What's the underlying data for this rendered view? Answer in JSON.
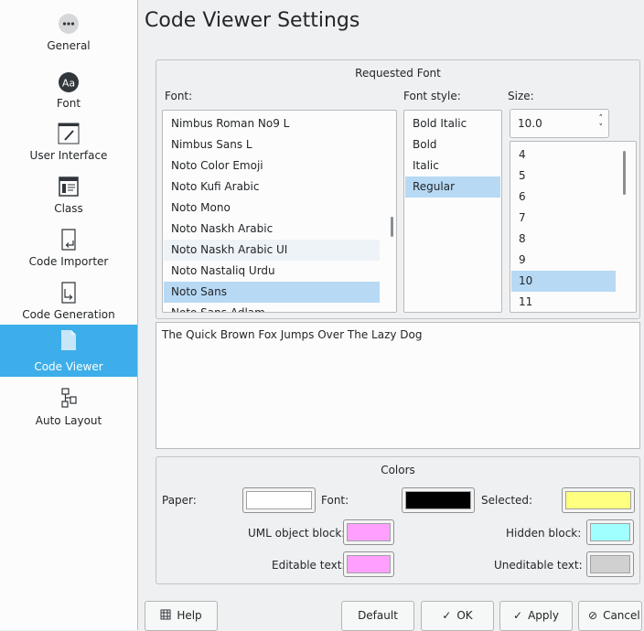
{
  "sidebar": {
    "items": [
      {
        "label": "General",
        "icon": "ellipsis-icon"
      },
      {
        "label": "Font",
        "icon": "font-aa-icon"
      },
      {
        "label": "User Interface",
        "icon": "pen-icon"
      },
      {
        "label": "Class",
        "icon": "class-icon"
      },
      {
        "label": "Code Importer",
        "icon": "code-importer-icon"
      },
      {
        "label": "Code Generation",
        "icon": "code-generation-icon"
      },
      {
        "label": "Code Viewer",
        "icon": "document-icon"
      },
      {
        "label": "Auto Layout",
        "icon": "auto-layout-icon"
      }
    ],
    "active": "Code Viewer",
    "accent": "#3daee9"
  },
  "page": {
    "title": "Code Viewer Settings"
  },
  "font_group": {
    "title": "Requested Font",
    "font_label": "Font:",
    "style_label": "Font style:",
    "size_label": "Size:",
    "fonts": [
      "Nimbus Roman No9 L",
      "Nimbus Sans L",
      "Noto Color Emoji",
      "Noto Kufi Arabic",
      "Noto Mono",
      "Noto Naskh Arabic",
      "Noto Naskh Arabic UI",
      "Noto Nastaliq Urdu",
      "Noto Sans",
      "Noto Sans Adlam"
    ],
    "selected_font": "Noto Sans",
    "styles": [
      "Bold Italic",
      "Bold",
      "Italic",
      "Regular"
    ],
    "selected_style": "Regular",
    "size_value": "10.0",
    "sizes": [
      "4",
      "5",
      "6",
      "7",
      "8",
      "9",
      "10",
      "11"
    ],
    "selected_size": "10"
  },
  "preview": {
    "text": "The Quick Brown Fox Jumps Over The Lazy Dog"
  },
  "colors_group": {
    "title": "Colors",
    "paper_label": "Paper:",
    "font_label": "Font:",
    "selected_label": "Selected:",
    "uml_label": "UML object block:",
    "hidden_label": "Hidden block:",
    "editable_label": "Editable text:",
    "uneditable_label": "Uneditable text:",
    "paper_color": "#ffffff",
    "font_color": "#000000",
    "selected_color": "#ffff80",
    "uml_color": "#ffa0ff",
    "hidden_color": "#a0ffff",
    "editable_color": "#ffa0ff",
    "uneditable_color": "#d0d0d0"
  },
  "buttons": {
    "help": "Help",
    "default": "Default",
    "ok": "OK",
    "apply": "Apply",
    "cancel": "Cancel"
  }
}
